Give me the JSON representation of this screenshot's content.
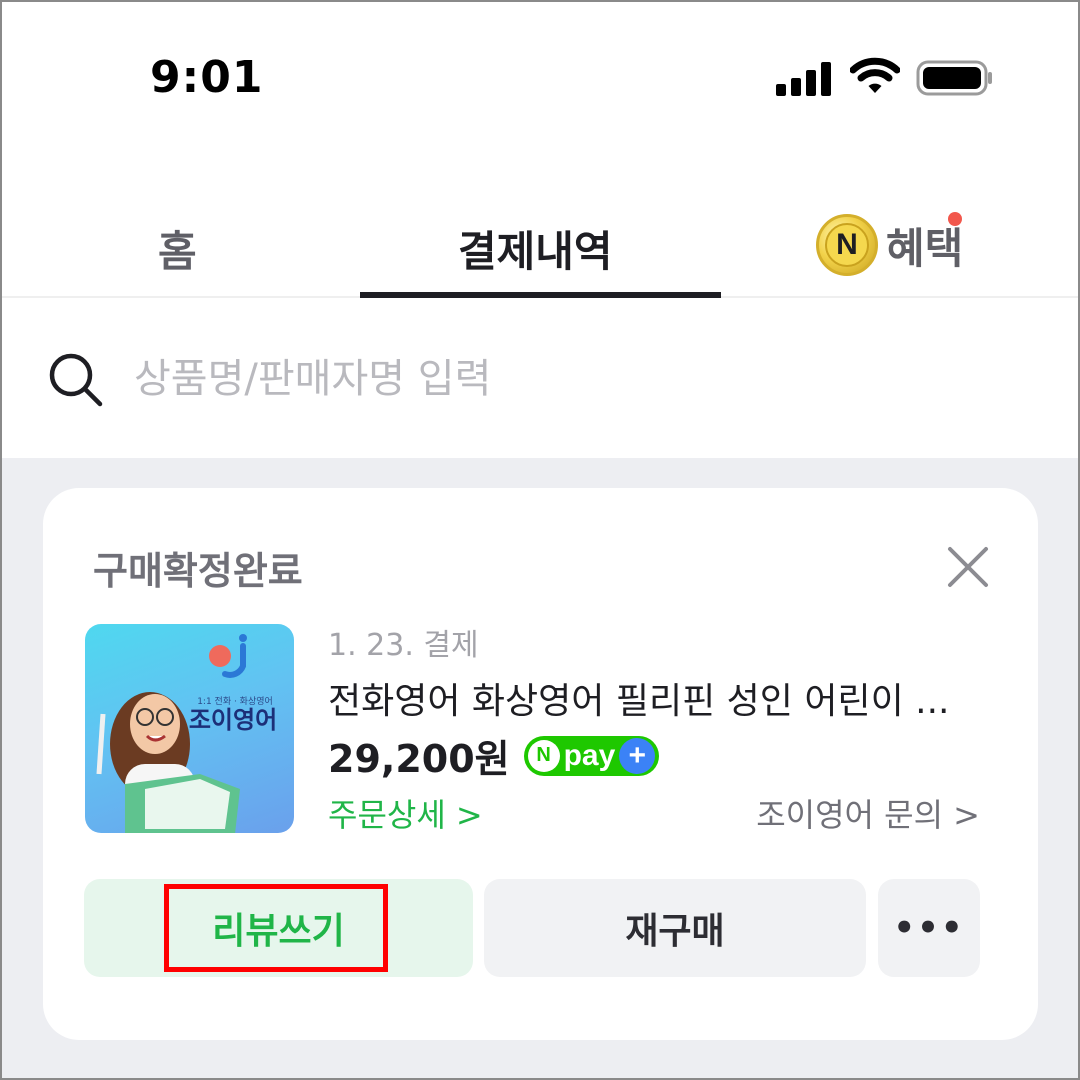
{
  "status_bar": {
    "time": "9:01"
  },
  "tabs": {
    "home": "홈",
    "payment_history": "결제내역",
    "benefits": "혜택",
    "coin_letter": "N",
    "active": "결제내역"
  },
  "search": {
    "placeholder": "상품명/판매자명 입력",
    "value": ""
  },
  "order_card": {
    "status": "구매확정완료",
    "payment_date": "1. 23. 결제",
    "product_name": "전화영어 화상영어 필리핀 성인 어린이 ...",
    "price": "29,200원",
    "npay": {
      "n_letter": "N",
      "text": "pay",
      "plus": "+"
    },
    "order_detail_link": "주문상세 >",
    "seller_inquiry_link": "조이영어 문의 >",
    "thumbnail": {
      "subtitle": "1:1 전화 · 화상영어",
      "brand": "조이영어"
    },
    "buttons": {
      "review": "리뷰쓰기",
      "rebuy": "재구매",
      "more": "•••"
    }
  },
  "colors": {
    "accent_green": "#20b548",
    "npay_green": "#1ec800",
    "notification_red": "#f2574c",
    "highlight_red": "#ff0000",
    "content_bg": "#edeef2"
  },
  "icons": [
    "signal-icon",
    "wifi-icon",
    "battery-icon",
    "coin-icon",
    "search-icon",
    "close-icon",
    "more-icon"
  ]
}
